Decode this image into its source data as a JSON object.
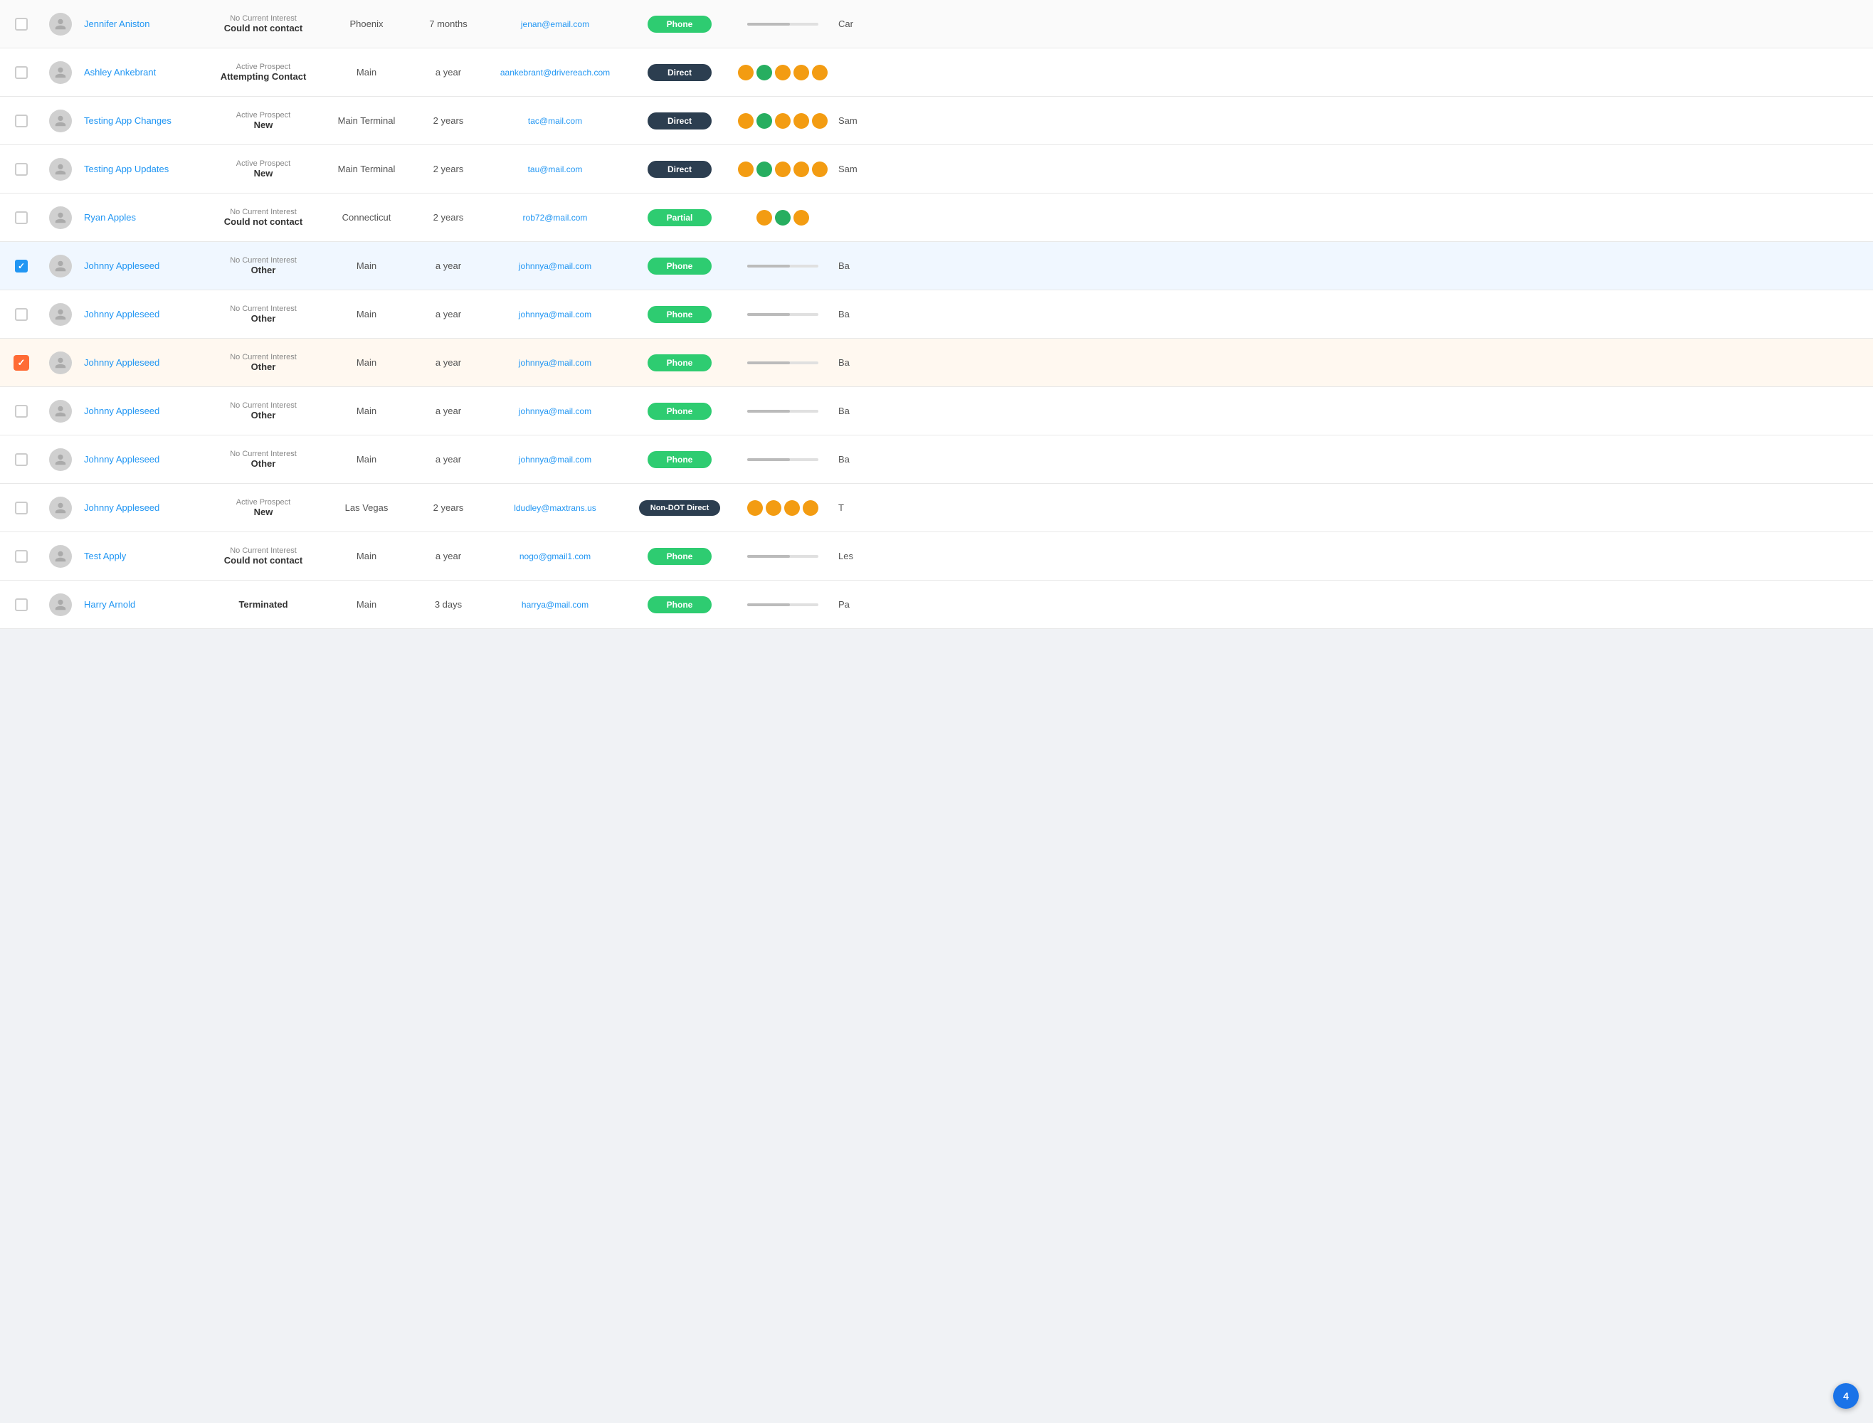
{
  "colors": {
    "phone_badge": "#2ecc71",
    "direct_badge": "#2c3e50",
    "partial_badge": "#2ecc71",
    "non_dot_badge": "#2c3e50",
    "dot_orange": "#f39c12",
    "dot_green": "#27ae60",
    "name_link": "#2196f3",
    "email_link": "#2196f3"
  },
  "rows": [
    {
      "id": 1,
      "checkbox": "empty",
      "name": "Jennifer Aniston",
      "status_label": "No Current Interest",
      "status_value": "Could not contact",
      "terminal": "Phoenix",
      "time": "7 months",
      "email": "jenan@email.com",
      "badge_type": "phone",
      "badge_label": "Phone",
      "dots": [],
      "progress": true,
      "extra": "Car"
    },
    {
      "id": 2,
      "checkbox": "empty",
      "name": "Ashley Ankebrant",
      "status_label": "Active Prospect",
      "status_value": "Attempting Contact",
      "terminal": "Main",
      "time": "a year",
      "email": "aankebrant@drivereach.com",
      "badge_type": "direct",
      "badge_label": "Direct",
      "dots": [
        "orange",
        "green",
        "orange",
        "orange",
        "orange"
      ],
      "progress": false,
      "extra": ""
    },
    {
      "id": 3,
      "checkbox": "empty",
      "name": "Testing App Changes",
      "status_label": "Active Prospect",
      "status_value": "New",
      "terminal": "Main Terminal",
      "time": "2 years",
      "email": "tac@mail.com",
      "badge_type": "direct",
      "badge_label": "Direct",
      "dots": [
        "orange",
        "green",
        "orange",
        "orange",
        "orange"
      ],
      "progress": false,
      "extra": "Sam"
    },
    {
      "id": 4,
      "checkbox": "empty",
      "name": "Testing App Updates",
      "status_label": "Active Prospect",
      "status_value": "New",
      "terminal": "Main Terminal",
      "time": "2 years",
      "email": "tau@mail.com",
      "badge_type": "direct",
      "badge_label": "Direct",
      "dots": [
        "orange",
        "green",
        "orange",
        "orange",
        "orange"
      ],
      "progress": false,
      "extra": "Sam"
    },
    {
      "id": 5,
      "checkbox": "empty",
      "name": "Ryan Apples",
      "status_label": "No Current Interest",
      "status_value": "Could not contact",
      "terminal": "Connecticut",
      "time": "2 years",
      "email": "rob72@mail.com",
      "badge_type": "partial",
      "badge_label": "Partial",
      "dots": [
        "orange",
        "green",
        "orange"
      ],
      "progress": false,
      "extra": ""
    },
    {
      "id": 6,
      "checkbox": "checked",
      "name": "Johnny Appleseed",
      "status_label": "No Current Interest",
      "status_value": "Other",
      "terminal": "Main",
      "time": "a year",
      "email": "johnnya@mail.com",
      "badge_type": "phone",
      "badge_label": "Phone",
      "dots": [],
      "progress": true,
      "extra": "Ba"
    },
    {
      "id": 7,
      "checkbox": "empty",
      "name": "Johnny Appleseed",
      "status_label": "No Current Interest",
      "status_value": "Other",
      "terminal": "Main",
      "time": "a year",
      "email": "johnnya@mail.com",
      "badge_type": "phone",
      "badge_label": "Phone",
      "dots": [],
      "progress": true,
      "extra": "Ba"
    },
    {
      "id": 8,
      "checkbox": "orange",
      "name": "Johnny Appleseed",
      "status_label": "No Current Interest",
      "status_value": "Other",
      "terminal": "Main",
      "time": "a year",
      "email": "johnnya@mail.com",
      "badge_type": "phone",
      "badge_label": "Phone",
      "dots": [],
      "progress": true,
      "extra": "Ba",
      "highlighted": true
    },
    {
      "id": 9,
      "checkbox": "empty",
      "name": "Johnny Appleseed",
      "status_label": "No Current Interest",
      "status_value": "Other",
      "terminal": "Main",
      "time": "a year",
      "email": "johnnya@mail.com",
      "badge_type": "phone",
      "badge_label": "Phone",
      "dots": [],
      "progress": true,
      "extra": "Ba"
    },
    {
      "id": 10,
      "checkbox": "empty",
      "name": "Johnny Appleseed",
      "status_label": "No Current Interest",
      "status_value": "Other",
      "terminal": "Main",
      "time": "a year",
      "email": "johnnya@mail.com",
      "badge_type": "phone",
      "badge_label": "Phone",
      "dots": [],
      "progress": true,
      "extra": "Ba"
    },
    {
      "id": 11,
      "checkbox": "empty",
      "name": "Johnny Appleseed",
      "status_label": "Active Prospect",
      "status_value": "New",
      "terminal": "Las Vegas",
      "time": "2 years",
      "email": "ldudley@maxtrans.us",
      "badge_type": "non-dot",
      "badge_label": "Non-DOT Direct",
      "dots": [
        "orange",
        "orange",
        "orange",
        "orange"
      ],
      "progress": false,
      "extra": "T"
    },
    {
      "id": 12,
      "checkbox": "empty",
      "name": "Test Apply",
      "status_label": "No Current Interest",
      "status_value": "Could not contact",
      "terminal": "Main",
      "time": "a year",
      "email": "nogo@gmail1.com",
      "badge_type": "phone",
      "badge_label": "Phone",
      "dots": [],
      "progress": true,
      "extra": "Les"
    },
    {
      "id": 13,
      "checkbox": "empty",
      "name": "Harry Arnold",
      "status_label": "",
      "status_value": "Terminated",
      "terminal": "Main",
      "time": "3 days",
      "email": "harrya@mail.com",
      "badge_type": "phone",
      "badge_label": "Phone",
      "dots": [],
      "progress": true,
      "extra": "Pa"
    }
  ],
  "notification_count": "4"
}
